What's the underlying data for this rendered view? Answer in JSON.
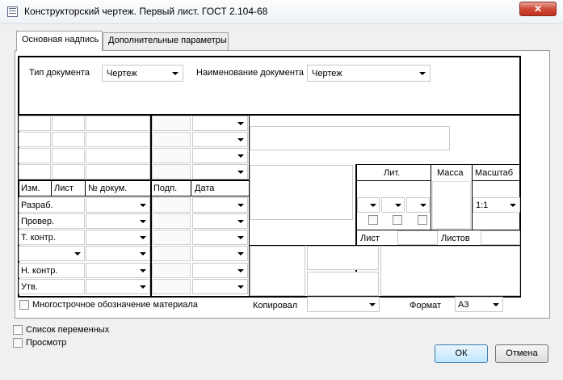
{
  "window": {
    "title": "Конструкторский чертеж. Первый лист. ГОСТ 2.104-68",
    "close_glyph": "✕"
  },
  "tabs": [
    {
      "label": "Основная надпись"
    },
    {
      "label": "Дополнительные параметры"
    }
  ],
  "header": {
    "doc_type_label": "Тип документа",
    "doc_type_value": "Чертеж",
    "doc_name_label": "Наименование документа",
    "doc_name_value": "Чертеж"
  },
  "grid": {
    "col_headers": [
      "Изм.",
      "Лист",
      "№ докум.",
      "Подп.",
      "Дата"
    ],
    "row_labels": [
      "Разраб.",
      "Провер.",
      "Т. контр.",
      "Н. контр.",
      "Утв."
    ]
  },
  "right_block": {
    "lit_label": "Лит.",
    "mass_label": "Масса",
    "scale_label": "Масштаб",
    "scale_value": "1:1",
    "sheet_label": "Лист",
    "sheets_label": "Листов"
  },
  "bottom": {
    "multiline_label": "Многострочное обозначение материала",
    "copied_label": "Копировал",
    "format_label": "Формат",
    "format_value": "А3"
  },
  "footer": {
    "variables_label": "Список переменных",
    "preview_label": "Просмотр",
    "ok_label": "ОК",
    "cancel_label": "Отмена"
  }
}
